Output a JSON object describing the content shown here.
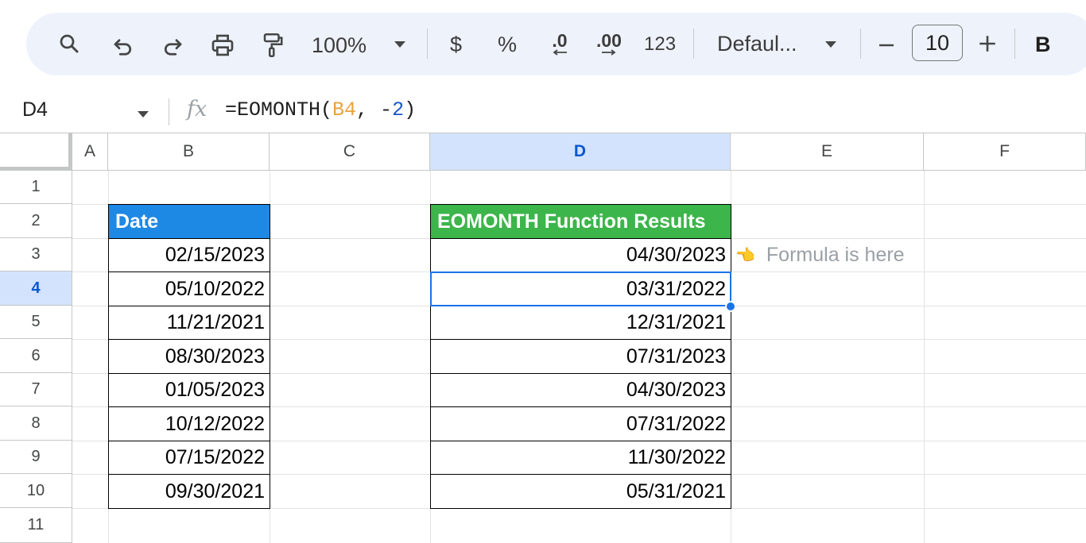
{
  "toolbar": {
    "zoom": "100%",
    "currency": "$",
    "percent": "%",
    "decrease_decimal": ".0",
    "increase_decimal": ".00",
    "number_format": "123",
    "font_family": "Defaul...",
    "font_size": "10",
    "bold": "B",
    "icons": [
      "search-icon",
      "undo-icon",
      "redo-icon",
      "print-icon",
      "paint-format-icon",
      "chevron-down-icon",
      "minus-icon",
      "plus-icon"
    ]
  },
  "formula_bar": {
    "cell_ref": "D4",
    "fx_label": "fx",
    "formula_prefix": "=EOMONTH(",
    "formula_ref": "B4",
    "formula_mid": ", -",
    "formula_num": "2",
    "formula_suffix": ")"
  },
  "columns": [
    "A",
    "B",
    "C",
    "D",
    "E",
    "F"
  ],
  "rows": [
    "1",
    "2",
    "3",
    "4",
    "5",
    "6",
    "7",
    "8",
    "9",
    "10",
    "11"
  ],
  "selected": {
    "column": "D",
    "row": "4"
  },
  "sheet": {
    "date_header": "Date",
    "result_header": "EOMONTH Function Results",
    "dates": [
      "02/15/2023",
      "05/10/2022",
      "11/21/2021",
      "08/30/2023",
      "01/05/2023",
      "10/12/2022",
      "07/15/2022",
      "09/30/2021"
    ],
    "results": [
      "04/30/2023",
      "03/31/2022",
      "12/31/2021",
      "07/31/2023",
      "04/30/2023",
      "07/31/2022",
      "11/30/2022",
      "05/31/2021"
    ],
    "note_icon": "👈",
    "note_text": "Formula is here"
  },
  "colors": {
    "date_header_bg": "#1e88e5",
    "result_header_bg": "#3cb54a",
    "selection": "#1a73e8",
    "header_selected_bg": "#d3e3fd"
  }
}
